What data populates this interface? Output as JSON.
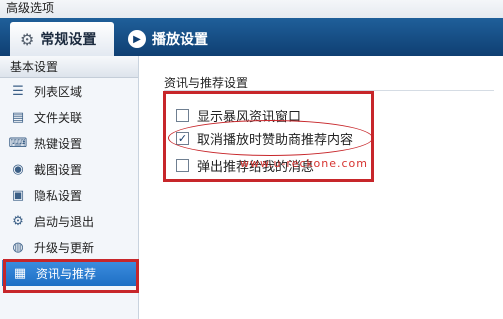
{
  "window": {
    "title": "高级选项"
  },
  "tabs": [
    {
      "label": "常规设置",
      "icon": "gear-icon",
      "active": true
    },
    {
      "label": "播放设置",
      "icon": "play-icon",
      "active": false
    }
  ],
  "sidebar": {
    "header": "基本设置",
    "items": [
      {
        "label": "列表区域",
        "icon": "list-icon"
      },
      {
        "label": "文件关联",
        "icon": "document-icon"
      },
      {
        "label": "热键设置",
        "icon": "keyboard-icon"
      },
      {
        "label": "截图设置",
        "icon": "camera-icon"
      },
      {
        "label": "隐私设置",
        "icon": "lock-icon"
      },
      {
        "label": "启动与退出",
        "icon": "gear-icon"
      },
      {
        "label": "升级与更新",
        "icon": "globe-icon"
      },
      {
        "label": "资讯与推荐",
        "icon": "news-icon",
        "selected": true
      }
    ]
  },
  "content": {
    "section_title": "资讯与推荐设置",
    "options": [
      {
        "label": "显示暴风资讯窗口",
        "checked": false
      },
      {
        "label": "取消播放时赞助商推荐内容",
        "checked": true
      },
      {
        "label": "弹出推荐给我的消息",
        "checked": false
      }
    ],
    "watermark": "www.u-reckone.com"
  },
  "colors": {
    "tab_bar": "#1f5f9a",
    "selected_item": "#2d7fd4",
    "highlight": "#c7262a"
  }
}
